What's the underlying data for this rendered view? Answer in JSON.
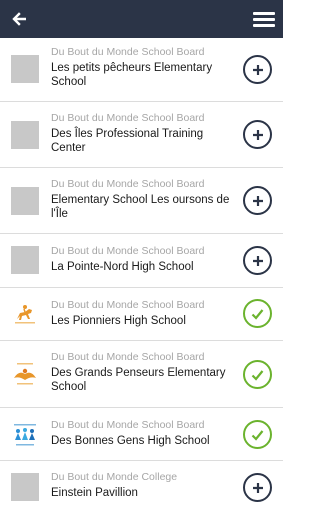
{
  "header": {
    "back_icon": "back-arrow-icon",
    "menu_icon": "hamburger-menu-icon",
    "background_color": "#2b3447"
  },
  "colors": {
    "add_button": "#2b3447",
    "added_check": "#6bb32e",
    "board_text": "#a6a6a6",
    "name_text": "#1a1a1a"
  },
  "schools": [
    {
      "board": "Du Bout du Monde School Board",
      "name": "Les petits pêcheurs Elementary School",
      "status": "add",
      "logo": "placeholder"
    },
    {
      "board": "Du Bout du Monde School Board",
      "name": "Des Îles Professional Training Center",
      "status": "add",
      "logo": "placeholder"
    },
    {
      "board": "Du Bout du Monde School Board",
      "name": "Elementary School Les oursons de l'Île",
      "status": "add",
      "logo": "placeholder"
    },
    {
      "board": "Du Bout du Monde School Board",
      "name": "La Pointe-Nord High School",
      "status": "add",
      "logo": "placeholder"
    },
    {
      "board": "Du Bout du Monde School Board",
      "name": "Les Pionniers High School",
      "status": "added",
      "logo": "horse-rider-logo"
    },
    {
      "board": "Du Bout du Monde School Board",
      "name": "Des Grands Penseurs Elementary School",
      "status": "added",
      "logo": "thinkers-logo"
    },
    {
      "board": "Du Bout du Monde School Board",
      "name": "Des Bonnes Gens High School",
      "status": "added",
      "logo": "people-logo"
    },
    {
      "board": "Du Bout du Monde College",
      "name": "Einstein Pavillion",
      "status": "add",
      "logo": "placeholder"
    }
  ]
}
